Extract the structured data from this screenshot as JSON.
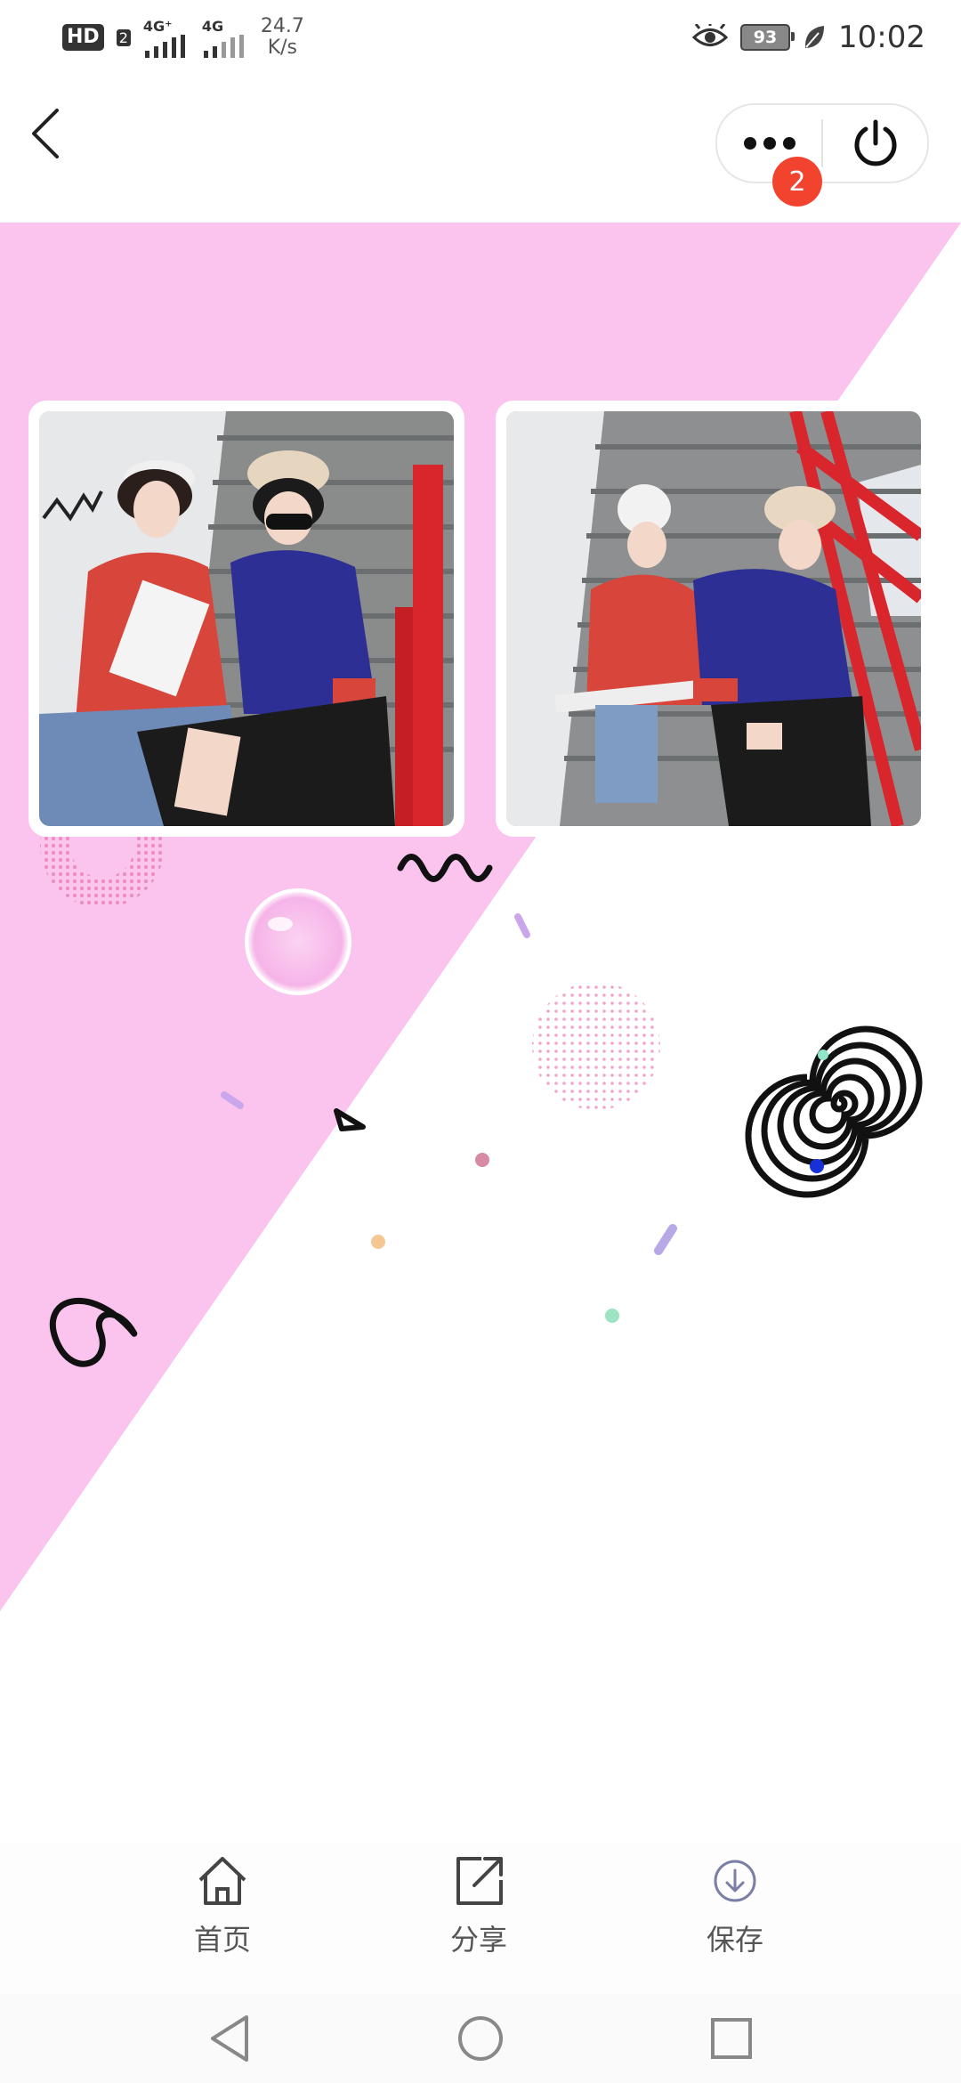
{
  "status_bar": {
    "hd": "HD",
    "sim1": "2",
    "net1": "4G⁺",
    "net2": "4G",
    "speed_value": "24.7",
    "speed_unit": "K/s",
    "battery": "93",
    "time": "10:02"
  },
  "nav": {
    "badge_count": "2"
  },
  "tabs": [
    {
      "label": "首页",
      "icon": "home-icon"
    },
    {
      "label": "分享",
      "icon": "share-icon"
    },
    {
      "label": "保存",
      "icon": "download-icon"
    }
  ],
  "colors": {
    "poster_pink": "#fac4ee",
    "badge_red": "#f2432f",
    "hoodie_red": "#d8453a",
    "hoodie_blue": "#2d2f94",
    "railing_red": "#d9262c"
  }
}
